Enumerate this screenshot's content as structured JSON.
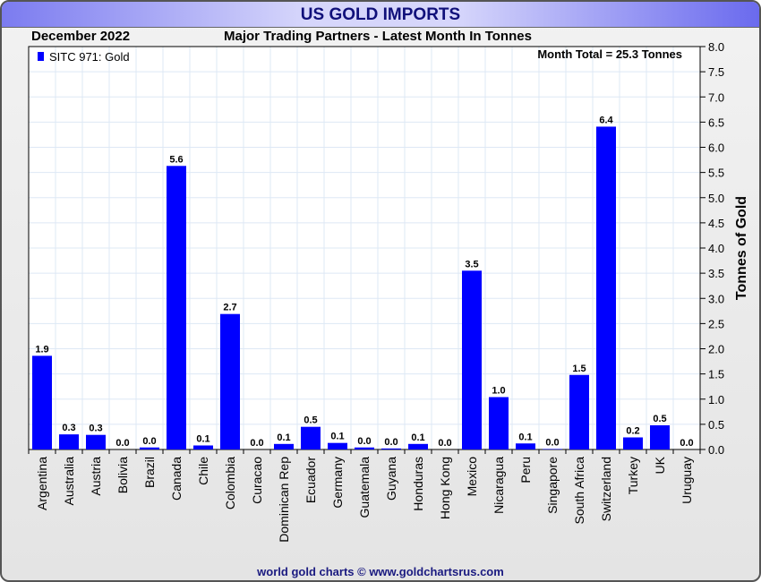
{
  "title": "US GOLD IMPORTS",
  "period": "December 2022",
  "footer": "world gold charts © www.goldchartsrus.com",
  "chart_data": {
    "type": "bar",
    "title": "Major Trading Partners - Latest Month In Tonnes",
    "ylabel": "Tonnes of Gold",
    "xlabel": "",
    "ylim": [
      0,
      8
    ],
    "yticks": [
      "0.0",
      "0.5",
      "1.0",
      "1.5",
      "2.0",
      "2.5",
      "3.0",
      "3.5",
      "4.0",
      "4.5",
      "5.0",
      "5.5",
      "6.0",
      "6.5",
      "7.0",
      "7.5",
      "8.0"
    ],
    "legend": "SITC 971: Gold",
    "legend_position": "top-left",
    "annotation": "Month Total = 25.3 Tonnes",
    "color": "#0000ff",
    "categories": [
      "Argentina",
      "Australia",
      "Austria",
      "Bolivia",
      "Brazil",
      "Canada",
      "Chile",
      "Colombia",
      "Curacao",
      "Dominican Rep",
      "Ecuador",
      "Germany",
      "Guatemala",
      "Guyana",
      "Honduras",
      "Hong Kong",
      "Mexico",
      "Nicaragua",
      "Peru",
      "Singapore",
      "South Africa",
      "Switzerland",
      "Turkey",
      "UK",
      "Uruguay"
    ],
    "values": [
      1.86,
      0.3,
      0.29,
      0.0,
      0.04,
      5.63,
      0.08,
      2.69,
      0.0,
      0.11,
      0.45,
      0.13,
      0.04,
      0.02,
      0.11,
      0.0,
      3.55,
      1.04,
      0.12,
      0.01,
      1.48,
      6.41,
      0.24,
      0.48,
      0.0
    ],
    "labels": [
      "1.9",
      "0.3",
      "0.3",
      "0.0",
      "0.0",
      "5.6",
      "0.1",
      "2.7",
      "0.0",
      "0.1",
      "0.5",
      "0.1",
      "0.0",
      "0.0",
      "0.1",
      "0.0",
      "3.5",
      "1.0",
      "0.1",
      "0.0",
      "1.5",
      "6.4",
      "0.2",
      "0.5",
      "0.0"
    ]
  }
}
